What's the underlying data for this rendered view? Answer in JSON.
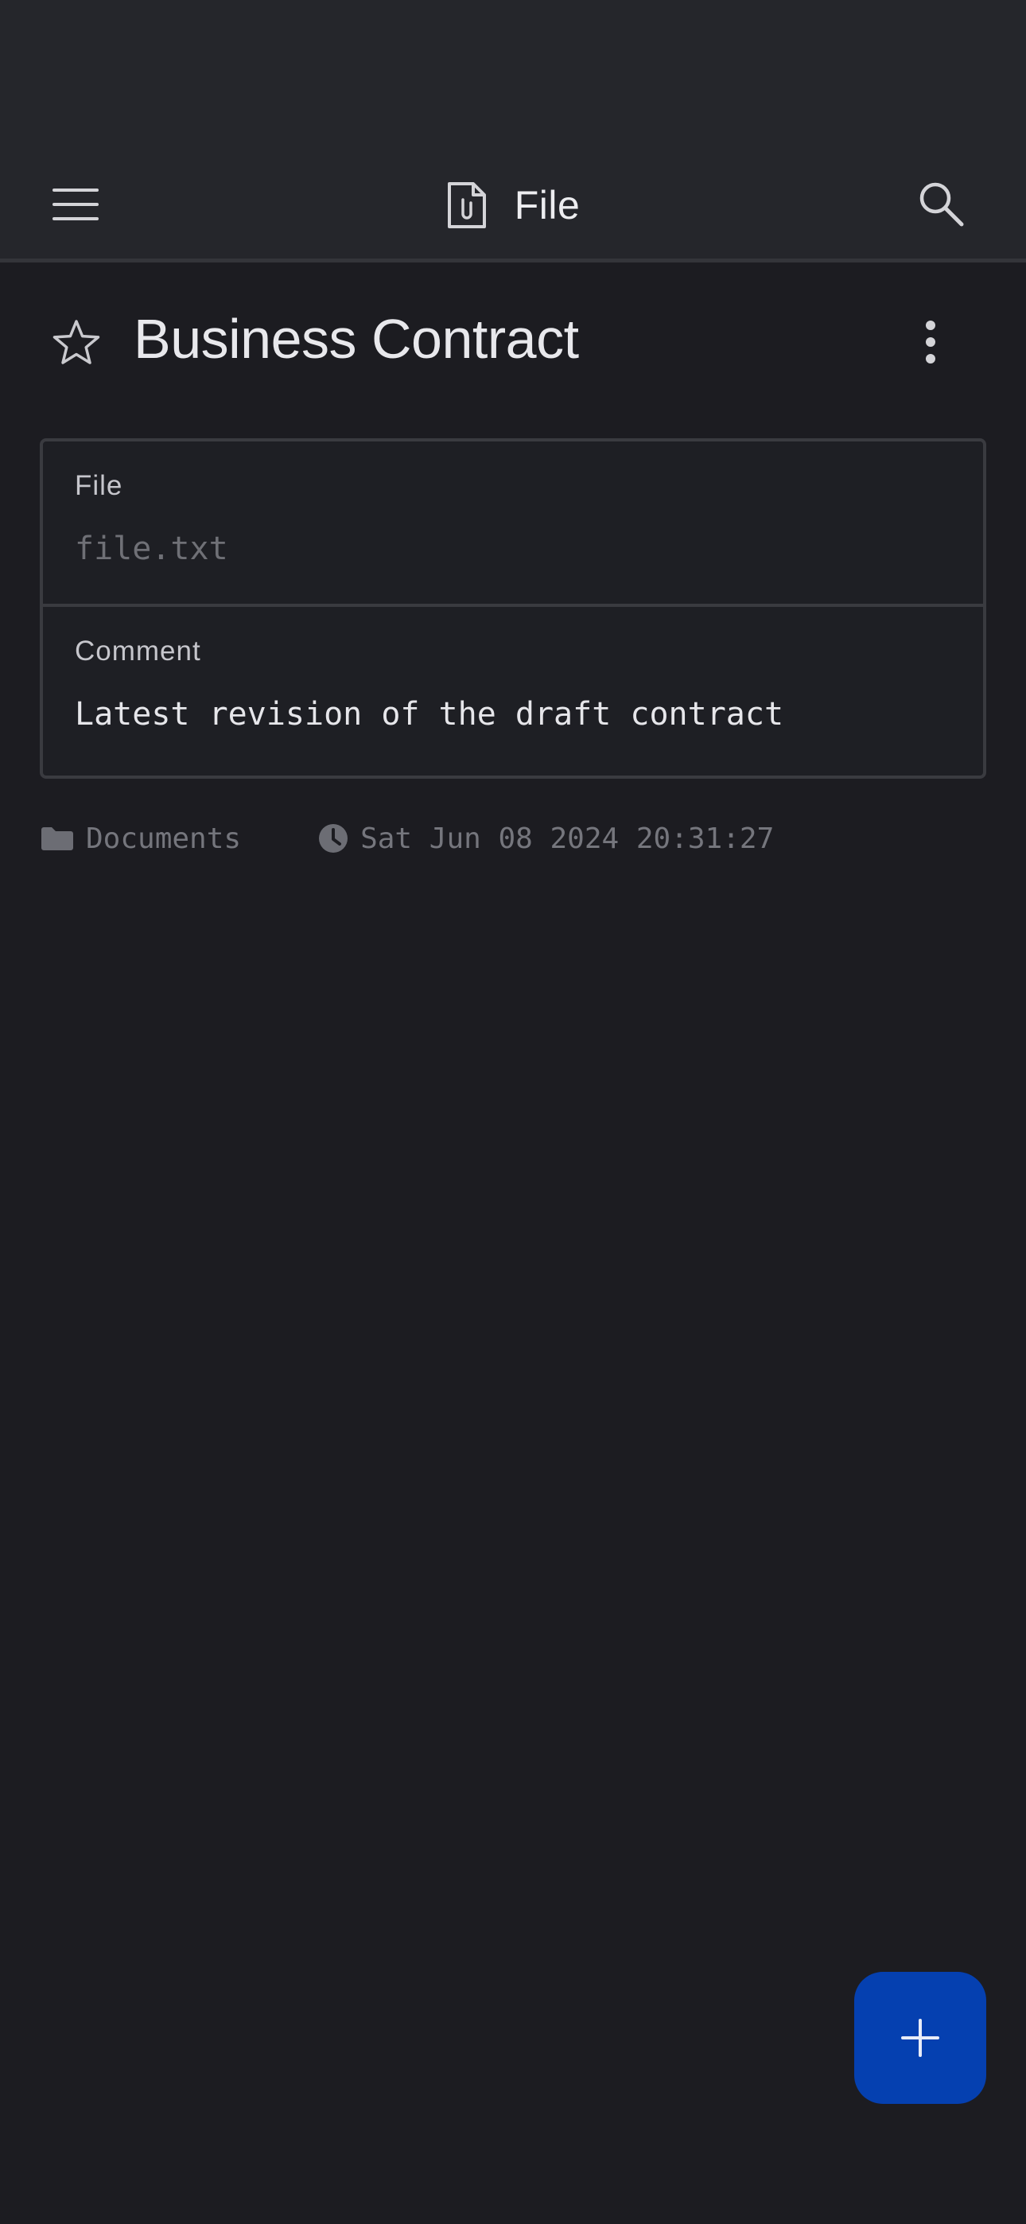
{
  "app_bar": {
    "title": "File",
    "menu_icon": "hamburger-menu-icon",
    "title_icon": "file-attachment-icon",
    "search_icon": "search-icon"
  },
  "note": {
    "title": "Business Contract",
    "starred": false,
    "favorite_icon": "star-outline-icon",
    "more_icon": "more-vertical-icon"
  },
  "fields": {
    "file": {
      "label": "File",
      "value": "file.txt"
    },
    "comment": {
      "label": "Comment",
      "value": "Latest revision of the draft contract"
    }
  },
  "meta": {
    "folder": "Documents",
    "folder_icon": "folder-icon",
    "timestamp": "Sat Jun 08 2024 20:31:27",
    "timestamp_icon": "clock-icon"
  },
  "fab": {
    "icon": "plus-icon"
  },
  "colors": {
    "background": "#1c1c21",
    "app_bar": "#25262b",
    "fab": "#0540b0",
    "muted_text": "#75767d"
  }
}
